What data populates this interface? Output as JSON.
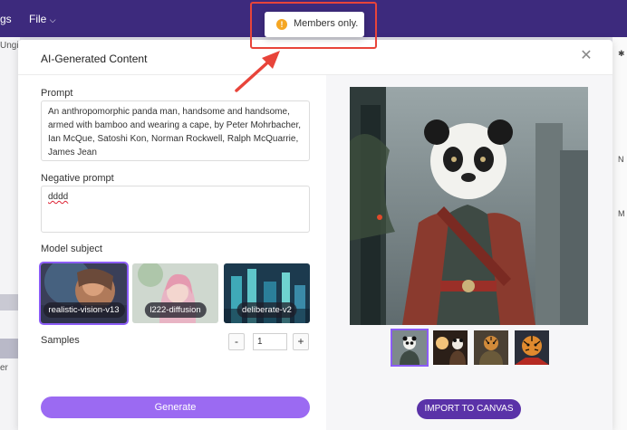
{
  "topbar": {
    "menu_left_fragment": "gs",
    "file_menu": "File"
  },
  "background": {
    "left_fragment_1": "Ungi",
    "left_fragment_2": "er",
    "right_fragment_1": "N",
    "right_fragment_2": "M"
  },
  "toast": {
    "icon": "warning-icon",
    "message": "Members only."
  },
  "dialog": {
    "title": "AI-Generated Content",
    "close_icon": "close-icon"
  },
  "form": {
    "prompt_label": "Prompt",
    "prompt_value": "An anthropomorphic panda man, handsome and handsome, armed with bamboo and wearing a cape,  by Peter Mohrbacher, Ian McQue, Satoshi Kon, Norman Rockwell, Ralph McQuarrie, James Jean",
    "negative_label": "Negative prompt",
    "negative_value": "dddd",
    "model_label": "Model subject",
    "models": [
      {
        "name": "realistic-vision-v13",
        "selected": true
      },
      {
        "name": "l222-diffusion",
        "selected": false
      },
      {
        "name": "deliberate-v2",
        "selected": false
      }
    ],
    "samples_label": "Samples",
    "samples_value": "1",
    "minus": "-",
    "plus": "+",
    "generate_label": "Generate"
  },
  "result": {
    "import_label": "IMPORT TO CANVAS",
    "thumbnails": [
      "panda",
      "panda-lamp",
      "tiger-warrior",
      "tiger-face"
    ],
    "selected_thumbnail": 0
  },
  "colors": {
    "accent": "#9b6af2",
    "import_button": "#5a32a8",
    "topbar": "#3d2a7d",
    "annotation": "#e8443a"
  }
}
